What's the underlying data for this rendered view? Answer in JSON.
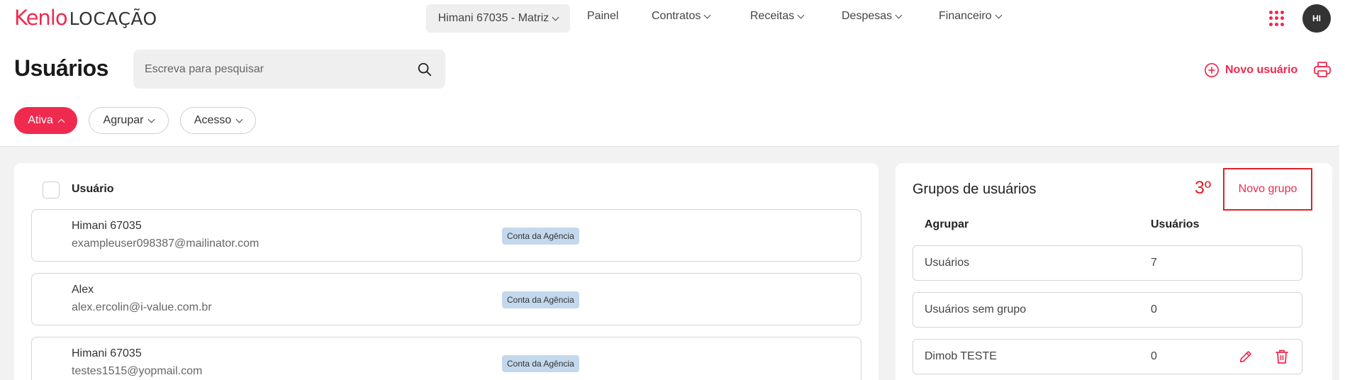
{
  "app": {
    "brand": "Kenlo",
    "product": "LOCAÇÃO"
  },
  "nav": {
    "branch": "Himani 67035 - Matriz",
    "items": [
      {
        "label": "Painel",
        "has_dropdown": false
      },
      {
        "label": "Contratos",
        "has_dropdown": true
      },
      {
        "label": "Receitas",
        "has_dropdown": true
      },
      {
        "label": "Despesas",
        "has_dropdown": true
      },
      {
        "label": "Financeiro",
        "has_dropdown": true
      }
    ],
    "avatar_initials": "HI"
  },
  "header": {
    "title": "Usuários",
    "search_placeholder": "Escreva para pesquisar",
    "new_user_label": "Novo usuário"
  },
  "filters": [
    {
      "label": "Ativa",
      "active": true
    },
    {
      "label": "Agrupar",
      "active": false
    },
    {
      "label": "Acesso",
      "active": false
    }
  ],
  "users": {
    "column_header": "Usuário",
    "rows": [
      {
        "name": "Himani 67035",
        "email": "exampleuser098387@mailinator.com",
        "badge": "Conta da Agência"
      },
      {
        "name": "Alex",
        "email": "alex.ercolin@i-value.com.br",
        "badge": "Conta da Agência"
      },
      {
        "name": "Himani 67035",
        "email": "testes1515@yopmail.com",
        "badge": "Conta da Agência"
      }
    ]
  },
  "groups": {
    "title": "Grupos de usuários",
    "step_annotation": "3º",
    "new_group_label": "Novo grupo",
    "col_group": "Agrupar",
    "col_users": "Usuários",
    "rows": [
      {
        "name": "Usuários",
        "count": "7",
        "editable": false
      },
      {
        "name": "Usuários sem grupo",
        "count": "0",
        "editable": false
      },
      {
        "name": "Dimob TESTE",
        "count": "0",
        "editable": true
      }
    ]
  },
  "colors": {
    "accent": "#f0294f",
    "badge_bg": "#c3d8ec",
    "annotation_red": "#e0202a"
  },
  "icons": [
    "chevron-down-icon",
    "apps-grid-icon",
    "search-icon",
    "plus-circle-icon",
    "print-icon",
    "chevron-up-icon",
    "edit-icon",
    "trash-icon"
  ]
}
